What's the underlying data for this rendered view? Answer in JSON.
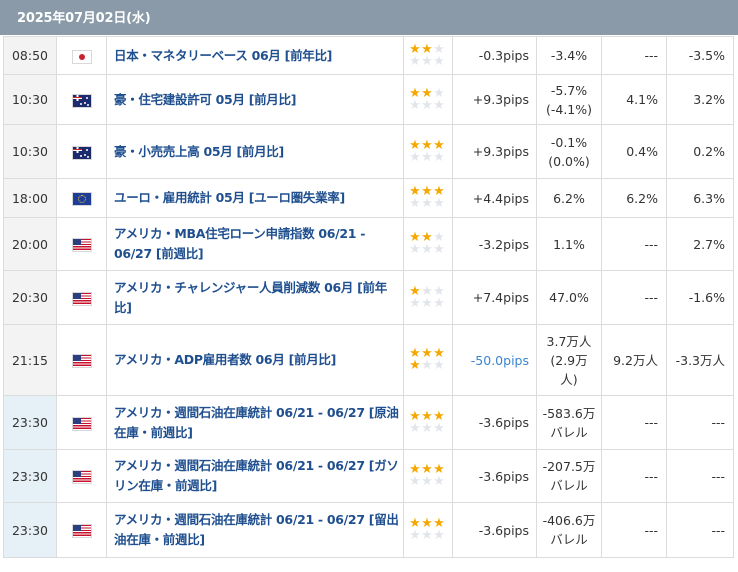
{
  "header": {
    "date": "2025年07月02日(水)"
  },
  "rows": [
    {
      "time": "08:50",
      "flag": "jp-flag-icon",
      "name": "日本・マネタリーベース 06月 [前年比]",
      "rating": 2,
      "pips": "-0.3pips",
      "prev_lines": [
        "-3.4%"
      ],
      "forecast": "---",
      "result": "-3.5%",
      "weekly": false,
      "strong": false
    },
    {
      "time": "10:30",
      "flag": "au-flag-icon",
      "name": "豪・住宅建設許可 05月 [前月比]",
      "rating": 2,
      "pips": "+9.3pips",
      "prev_lines": [
        "-5.7%",
        "(-4.1%)"
      ],
      "forecast": "4.1%",
      "result": "3.2%",
      "weekly": false,
      "strong": false
    },
    {
      "time": "10:30",
      "flag": "au-flag-icon",
      "name": "豪・小売売上高 05月 [前月比]",
      "rating": 3,
      "pips": "+9.3pips",
      "prev_lines": [
        "-0.1%",
        "(0.0%)"
      ],
      "forecast": "0.4%",
      "result": "0.2%",
      "weekly": false,
      "strong": false
    },
    {
      "time": "18:00",
      "flag": "eu-flag-icon",
      "name": "ユーロ・雇用統計 05月 [ユーロ圏失業率]",
      "rating": 3,
      "pips": "+4.4pips",
      "prev_lines": [
        "6.2%"
      ],
      "forecast": "6.2%",
      "result": "6.3%",
      "weekly": false,
      "strong": false
    },
    {
      "time": "20:00",
      "flag": "us-flag-icon",
      "name": "アメリカ・MBA住宅ローン申請指数 06/21 - 06/27 [前週比]",
      "rating": 2,
      "pips": "-3.2pips",
      "prev_lines": [
        "1.1%"
      ],
      "forecast": "---",
      "result": "2.7%",
      "weekly": false,
      "strong": false
    },
    {
      "time": "20:30",
      "flag": "us-flag-icon",
      "name": "アメリカ・チャレンジャー人員削減数 06月 [前年比]",
      "rating": 1,
      "pips": "+7.4pips",
      "prev_lines": [
        "47.0%"
      ],
      "forecast": "---",
      "result": "-1.6%",
      "weekly": false,
      "strong": false
    },
    {
      "time": "21:15",
      "flag": "us-flag-icon",
      "name": "アメリカ・ADP雇用者数 06月 [前月比]",
      "rating": 4,
      "pips": "-50.0pips",
      "prev_lines": [
        "3.7万人",
        "(2.9万",
        "人)"
      ],
      "forecast": "9.2万人",
      "result": "-3.3万人",
      "weekly": false,
      "strong": true
    },
    {
      "time": "23:30",
      "flag": "us-flag-icon",
      "name": "アメリカ・週間石油在庫統計 06/21 - 06/27 [原油在庫・前週比]",
      "rating": 3,
      "pips": "-3.6pips",
      "prev_lines": [
        "-583.6万",
        "バレル"
      ],
      "forecast": "---",
      "result": "---",
      "weekly": true,
      "strong": false
    },
    {
      "time": "23:30",
      "flag": "us-flag-icon",
      "name": "アメリカ・週間石油在庫統計 06/21 - 06/27 [ガソリン在庫・前週比]",
      "rating": 3,
      "pips": "-3.6pips",
      "prev_lines": [
        "-207.5万",
        "バレル"
      ],
      "forecast": "---",
      "result": "---",
      "weekly": true,
      "strong": false
    },
    {
      "time": "23:30",
      "flag": "us-flag-icon",
      "name": "アメリカ・週間石油在庫統計 06/21 - 06/27 [留出油在庫・前週比]",
      "rating": 3,
      "pips": "-3.6pips",
      "prev_lines": [
        "-406.6万",
        "バレル"
      ],
      "forecast": "---",
      "result": "---",
      "weekly": true,
      "strong": false
    }
  ],
  "colors": {
    "header_bg": "#8a9aa8",
    "link": "#1f4f8f",
    "star_on": "#f4a800",
    "star_off": "#e2e6ea",
    "strong_pips": "#3a86cf"
  }
}
